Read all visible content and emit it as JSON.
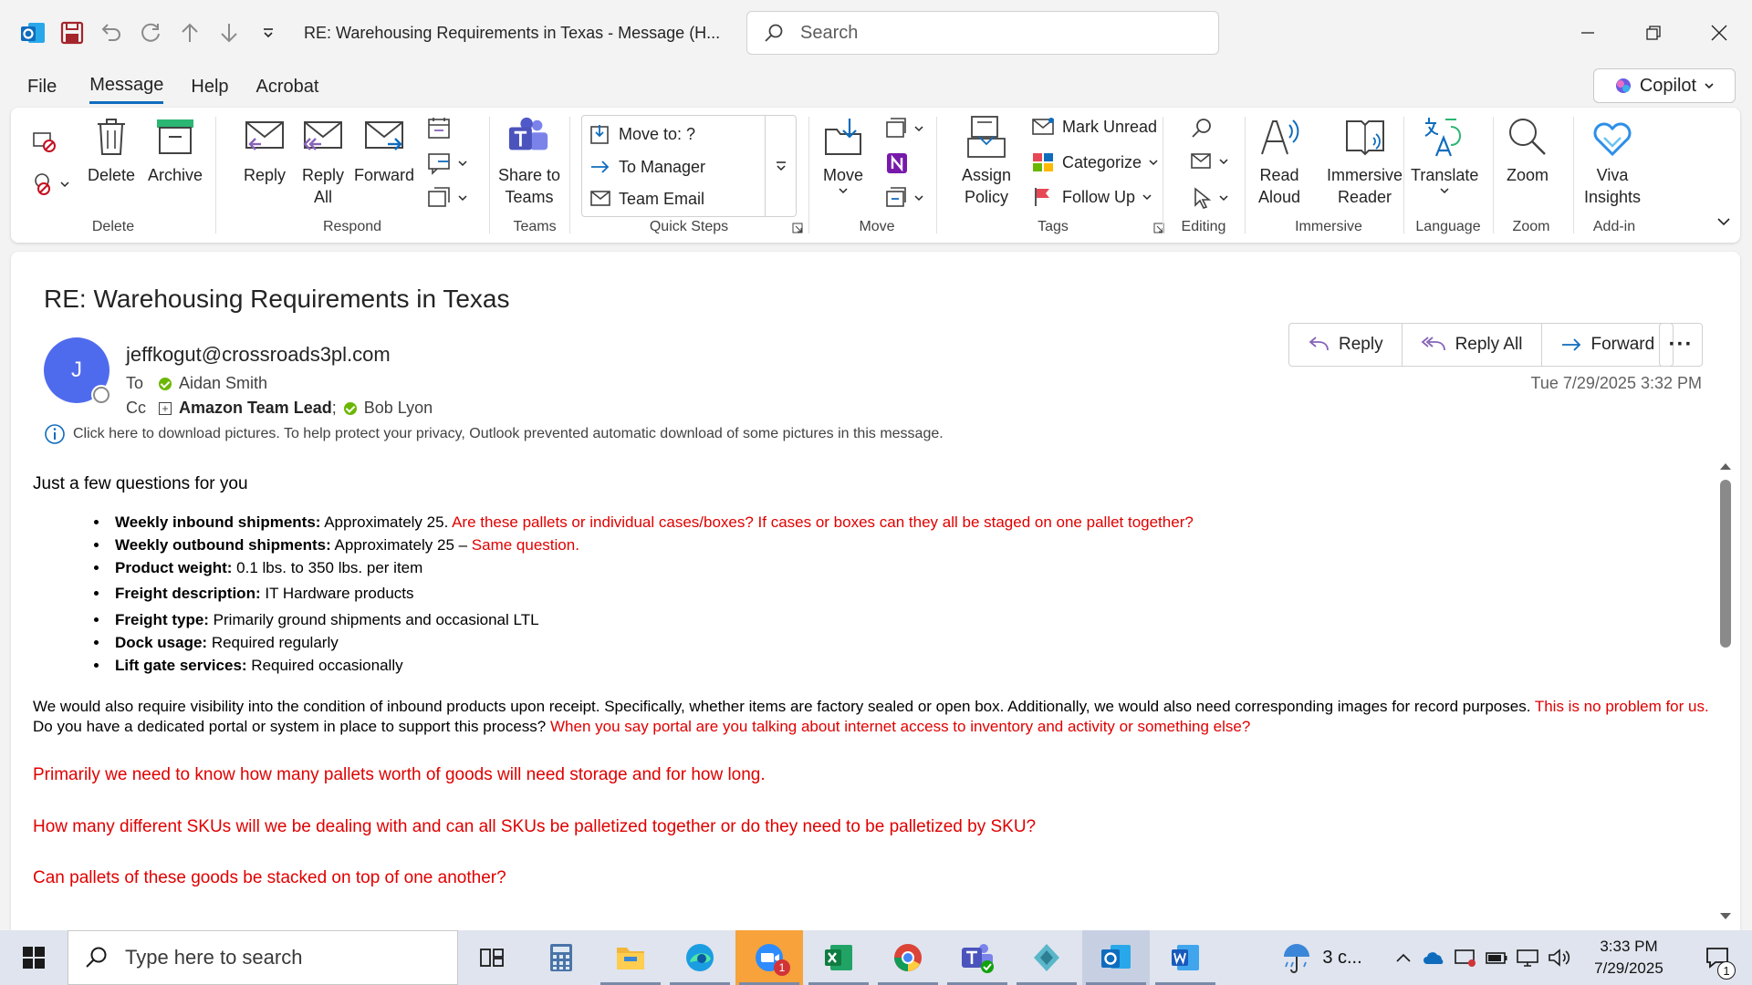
{
  "window": {
    "title": "RE: Warehousing Requirements in Texas  -  Message (H..."
  },
  "search": {
    "placeholder": "Search"
  },
  "menu": {
    "items": [
      "File",
      "Message",
      "Help",
      "Acrobat"
    ],
    "copilot": "Copilot"
  },
  "ribbon": {
    "groups": {
      "delete": "Delete",
      "respond": "Respond",
      "teams": "Teams",
      "quicksteps": "Quick Steps",
      "move": "Move",
      "tags": "Tags",
      "editing": "Editing",
      "immersive": "Immersive",
      "language": "Language",
      "zoom": "Zoom",
      "addin": "Add-in"
    },
    "delete": "Delete",
    "archive": "Archive",
    "reply": "Reply",
    "reply_all_1": "Reply",
    "reply_all_2": "All",
    "forward": "Forward",
    "share_teams_1": "Share to",
    "share_teams_2": "Teams",
    "qs_move": "Move to: ?",
    "qs_manager": "To Manager",
    "qs_team": "Team Email",
    "move": "Move",
    "assign_1": "Assign",
    "assign_2": "Policy",
    "mark_unread": "Mark Unread",
    "categorize": "Categorize",
    "follow_up": "Follow Up",
    "read_1": "Read",
    "read_2": "Aloud",
    "immersive_1": "Immersive",
    "immersive_2": "Reader",
    "translate": "Translate",
    "zoom": "Zoom",
    "viva_1": "Viva",
    "viva_2": "Insights"
  },
  "message": {
    "subject": "RE: Warehousing Requirements in Texas",
    "avatar_initial": "J",
    "sender": "jeffkogut@crossroads3pl.com",
    "to_label": "To",
    "to": "Aidan Smith",
    "cc_label": "Cc",
    "cc1": "Amazon Team Lead",
    "cc_sep": ";",
    "cc2": "Bob Lyon",
    "date": "Tue 7/29/2025 3:32 PM",
    "actions": {
      "reply": "Reply",
      "reply_all": "Reply All",
      "forward": "Forward"
    },
    "info": "Click here to download pictures. To help protect your privacy, Outlook prevented automatic download of some pictures in this message."
  },
  "body": {
    "intro": "Just a few questions for you",
    "bullets": [
      {
        "label": "Weekly inbound shipments:",
        "text": " Approximately 25. ",
        "red": "Are these pallets or individual cases/boxes?  If cases or boxes can they all be staged on one pallet together?"
      },
      {
        "label": "Weekly outbound shipments:",
        "text": " Approximately 25 – ",
        "red": "Same question."
      },
      {
        "label": "Product weight:",
        "text": " 0.1 lbs. to 350 lbs. per item",
        "red": ""
      },
      {
        "label": "Freight description:",
        "text": " IT Hardware products",
        "red": ""
      },
      {
        "label": "Freight type:",
        "text": " Primarily ground shipments and occasional LTL",
        "red": ""
      },
      {
        "label": "Dock usage:",
        "text": " Required regularly",
        "red": ""
      },
      {
        "label": "Lift gate services:",
        "text": " Required occasionally",
        "red": ""
      }
    ],
    "para_a": "We would also require visibility into the condition of inbound products upon receipt. Specifically, whether items are factory sealed or open box. Additionally, we would also need corresponding images for record purposes. ",
    "para_a_red": "This is no problem for us.",
    "para_b": " Do you have a dedicated portal or system in place to support this process? ",
    "para_b_red": "When you say portal are you talking about internet access to inventory and activity or something else?",
    "q1": "Primarily we need to know how many pallets worth of goods will need storage and for how long.",
    "q2": "How many different SKUs will we be dealing with and can all SKUs be palletized together or do they need to be palletized by SKU?",
    "q3": "Can pallets of these goods be stacked on top of one another?"
  },
  "taskbar": {
    "search_placeholder": "Type here to search",
    "weather": "3 c...",
    "time": "3:33 PM",
    "date": "7/29/2025",
    "zoom_badge": "1",
    "notif_badge": "1"
  }
}
